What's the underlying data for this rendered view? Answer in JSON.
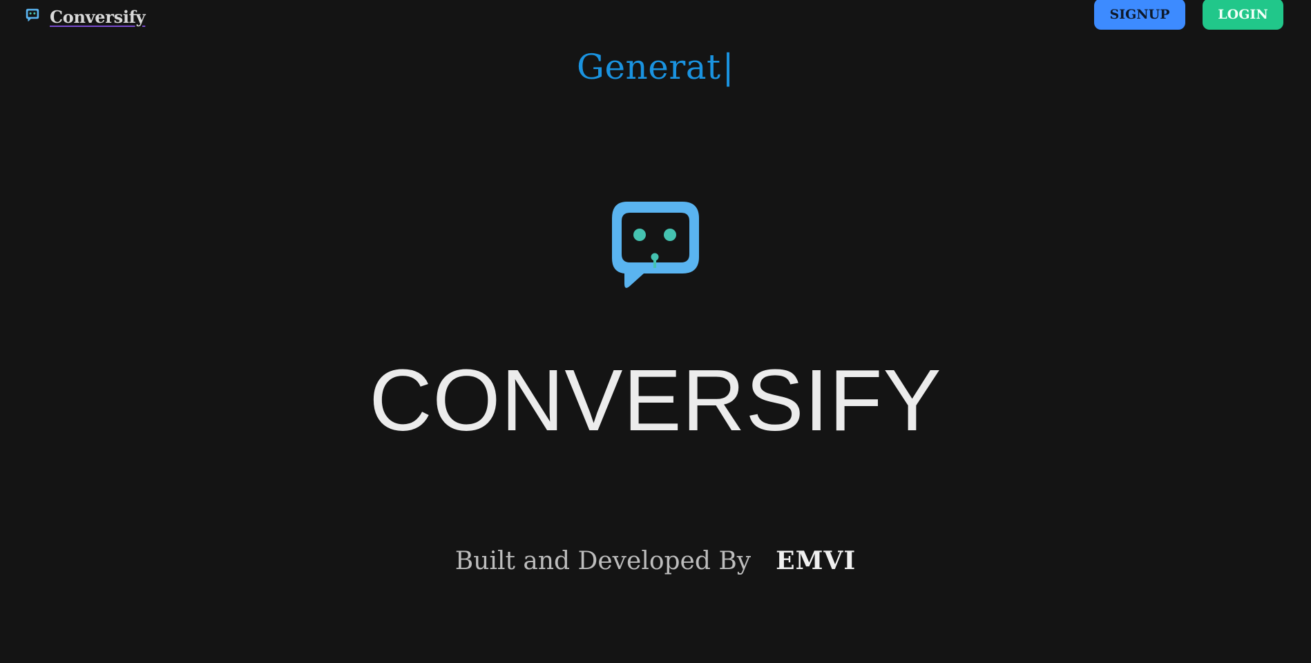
{
  "header": {
    "brand_name": "Conversify",
    "brand_icon": "chatbot-icon",
    "signup_label": "SIGNUP",
    "login_label": "LOGIN"
  },
  "hero": {
    "typed_text": "Generat",
    "caret": "|",
    "logo_icon": "chatbot-logo-icon",
    "title": "CONVERSIFY"
  },
  "credits": {
    "label": "Built and Developed By",
    "author": "EMVI"
  },
  "colors": {
    "background": "#141414",
    "typewriter": "#1a93e0",
    "signup": "#3d8bff",
    "login": "#21c78a",
    "logo_bubble": "#5ab4f0",
    "logo_eyes": "#45c2b0"
  }
}
